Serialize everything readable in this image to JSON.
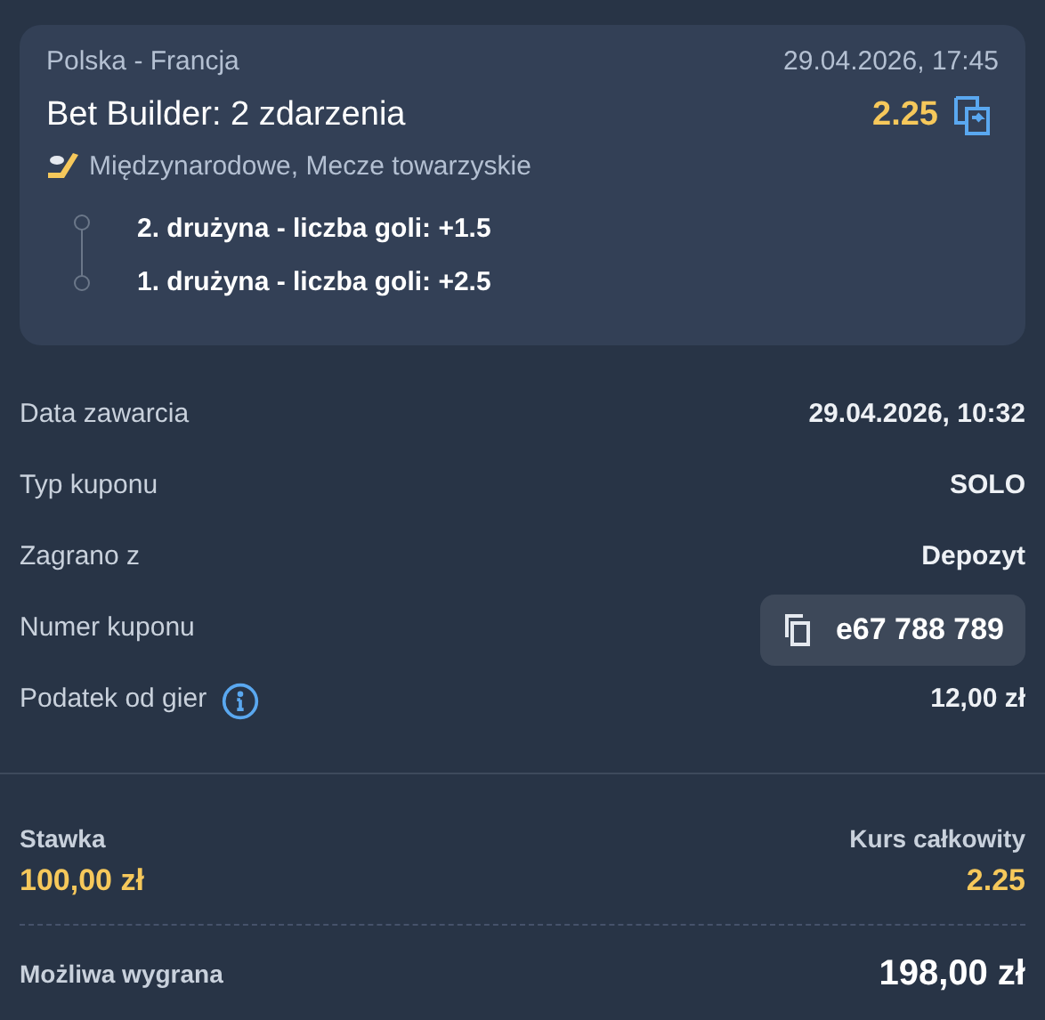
{
  "event": {
    "teams": "Polska - Francja",
    "date": "29.04.2026, 17:45",
    "title": "Bet Builder: 2 zdarzenia",
    "odds": "2.25",
    "league": "Międzynarodowe, Mecze towarzyskie",
    "selections": [
      "2. drużyna - liczba goli: +1.5",
      "1. drużyna - liczba goli: +2.5"
    ]
  },
  "details": [
    {
      "kind": "text",
      "label": "Data zawarcia",
      "value": "29.04.2026, 10:32"
    },
    {
      "kind": "text",
      "label": "Typ kuponu",
      "value": "SOLO"
    },
    {
      "kind": "text",
      "label": "Zagrano z",
      "value": "Depozyt"
    },
    {
      "kind": "coupon",
      "label": "Numer kuponu",
      "value": "e67 788 789"
    },
    {
      "kind": "info",
      "label": "Podatek od gier",
      "value": "12,00 zł"
    }
  ],
  "summary": {
    "stake_label": "Stawka",
    "stake": "100,00 zł",
    "odds_label": "Kurs całkowity",
    "odds": "2.25",
    "win_label": "Możliwa wygrana",
    "win": "198,00 zł"
  }
}
